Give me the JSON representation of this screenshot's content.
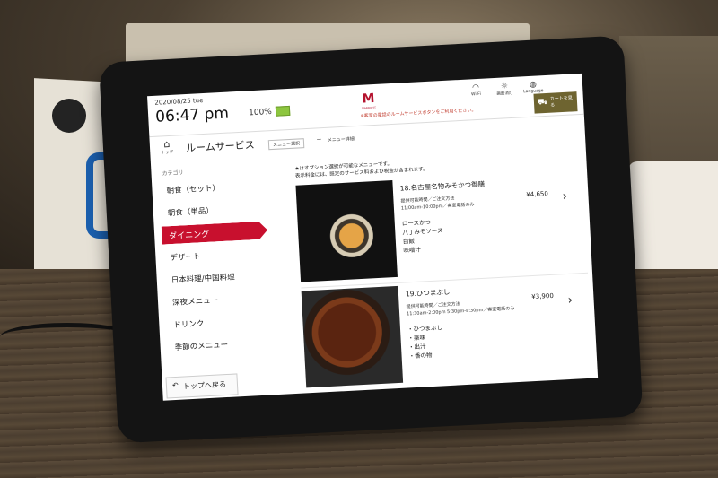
{
  "header": {
    "date": "2020/08/25 tue",
    "time": "06:47 pm",
    "battery": "100%",
    "brand_mark": "M",
    "brand_name": "MARRIOTT",
    "notice": "※客室の電話のルームサービスボタンをご利用ください。",
    "icons": [
      {
        "name": "wifi-icon",
        "label": "Wi-Fi"
      },
      {
        "name": "brightness-icon",
        "label": "画面消灯"
      },
      {
        "name": "globe-icon",
        "label": "Language"
      }
    ],
    "cart_label": "カートを見る"
  },
  "nav": {
    "home_label": "トップ",
    "service_title": "ルームサービス",
    "crumbs": [
      "メニュー選択",
      "メニュー詳細"
    ]
  },
  "sidebar": {
    "category_label": "カテゴリ",
    "items": [
      "朝食（セット）",
      "朝食（単品）",
      "ダイニング",
      "デザート",
      "日本料理/中国料理",
      "深夜メニュー",
      "ドリンク",
      "季節のメニュー"
    ],
    "active_item": "ダイニング",
    "back_label": "トップへ戻る"
  },
  "main": {
    "option_note": "★はオプション選択が可能なメニューです。",
    "price_note": "表示料金には、既定のサービス料および税金が含まれます。",
    "menu_items": [
      {
        "name": "18.名古屋名物みそかつ御膳",
        "sub_label": "提供可能時間／ご注文方法",
        "hours": "11:00am-10:00pm／客室電話のみ",
        "price": "¥4,650",
        "contents": [
          "ロースかつ",
          "八丁みそソース",
          "白飯",
          "味噌汁"
        ]
      },
      {
        "name": "19.ひつまぶし",
        "sub_label": "提供可能時間／ご注文方法",
        "hours": "11:30am-2:00pm 5:30pm-8:30pm／客室電話のみ",
        "price": "¥3,900",
        "contents": [
          "・ひつまぶし",
          "・薬味",
          "・出汁",
          "・香の物"
        ]
      }
    ]
  },
  "colors": {
    "accent_red": "#c8102e",
    "brand_red": "#b4122e",
    "cart_olive": "#6e6430",
    "battery_green": "#8dc63f"
  }
}
